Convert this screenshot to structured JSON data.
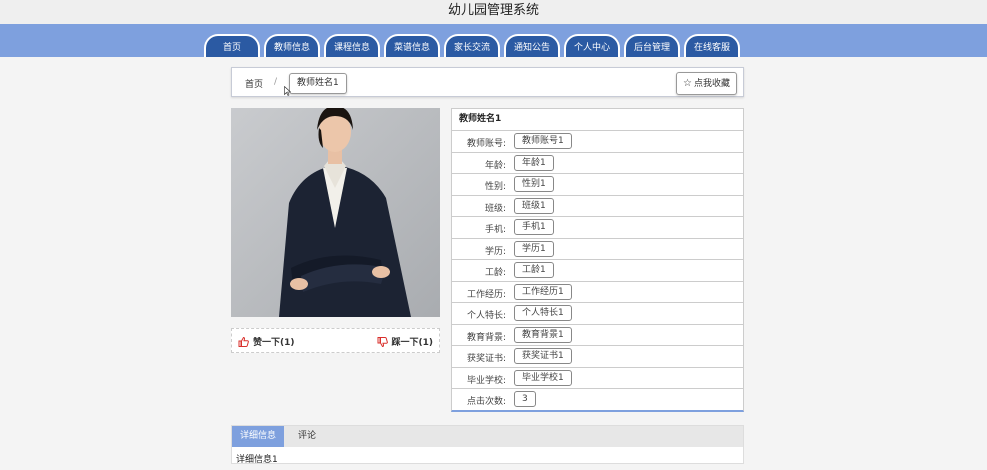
{
  "header": {
    "title": "幼儿园管理系统"
  },
  "nav": {
    "tabs": [
      "首页",
      "教师信息",
      "课程信息",
      "菜谱信息",
      "家长交流",
      "通知公告",
      "个人中心",
      "后台管理",
      "在线客服"
    ]
  },
  "breadcrumb": {
    "home": "首页",
    "separator": "/",
    "current": "教师姓名1",
    "favorite_label": "点我收藏"
  },
  "votes": {
    "like_label": "赞一下(1)",
    "dislike_label": "踩一下(1)"
  },
  "teacher": {
    "title": "教师姓名1",
    "fields": [
      {
        "label": "教师账号:",
        "value": "教师账号1"
      },
      {
        "label": "年龄:",
        "value": "年龄1"
      },
      {
        "label": "性别:",
        "value": "性别1"
      },
      {
        "label": "班级:",
        "value": "班级1"
      },
      {
        "label": "手机:",
        "value": "手机1"
      },
      {
        "label": "学历:",
        "value": "学历1"
      },
      {
        "label": "工龄:",
        "value": "工龄1"
      },
      {
        "label": "工作经历:",
        "value": "工作经历1"
      },
      {
        "label": "个人特长:",
        "value": "个人特长1"
      },
      {
        "label": "教育背景:",
        "value": "教育背景1"
      },
      {
        "label": "获奖证书:",
        "value": "获奖证书1"
      },
      {
        "label": "毕业学校:",
        "value": "毕业学校1"
      },
      {
        "label": "点击次数:",
        "value": "3"
      }
    ]
  },
  "detail": {
    "tabs": [
      "详细信息",
      "评论"
    ],
    "body": "详细信息1"
  },
  "colors": {
    "nav_bar": "#7ea0de",
    "nav_tab": "#2b5aa3",
    "vote_icon": "#d9302c"
  }
}
